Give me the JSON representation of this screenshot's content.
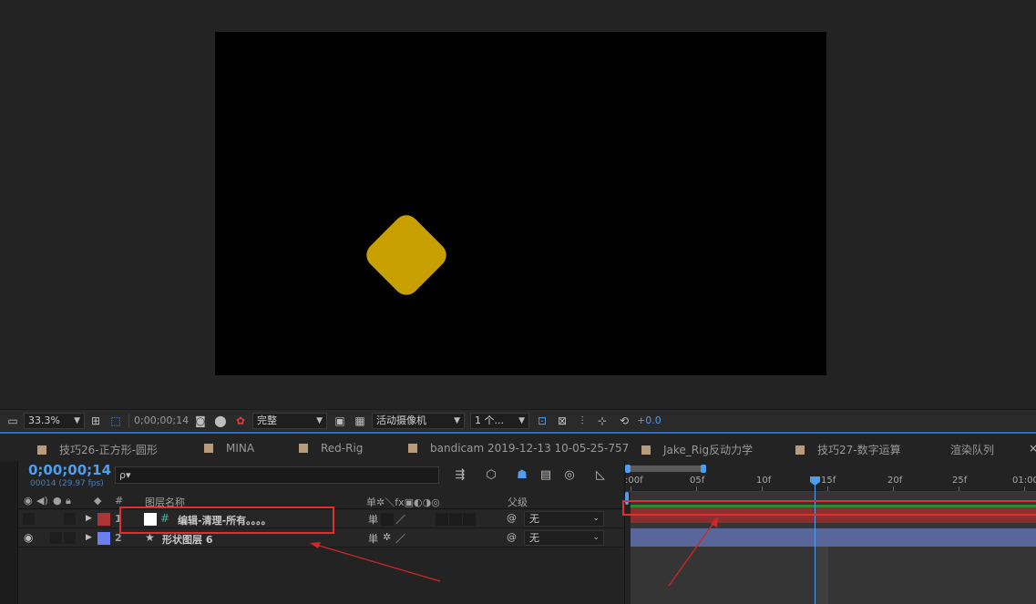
{
  "viewer": {
    "toolbar": {
      "zoom": "33.3%",
      "timecode": "0;00;00;14",
      "resolution": "完整",
      "camera": "活动摄像机",
      "views": "1 个...",
      "exposure": "+0.0"
    }
  },
  "tabs": [
    {
      "label": "技巧26-正方形-圆形"
    },
    {
      "label": "MINA"
    },
    {
      "label": "Red-Rig"
    },
    {
      "label": "bandicam 2019-12-13 10-05-25-757"
    },
    {
      "label": "Jake_Rig反动力学"
    },
    {
      "label": "技巧27-数字运算"
    },
    {
      "label": "渲染队列"
    }
  ],
  "close_glyph": "×",
  "timeline_panel": {
    "current_time": "0;00;00;14",
    "frame_info": "00014 (29.97 fps)",
    "search_glyph": "ρ▾",
    "headers": {
      "num": "#",
      "layer_name": "图层名称",
      "switch_glyphs": "单✲＼fx▣◐◑◎",
      "parent": "父级"
    },
    "layers": [
      {
        "num": "1",
        "type_glyph": "#",
        "name": "编辑-清理-所有。。。。",
        "label_color": "#b13434",
        "parent": "无"
      },
      {
        "num": "2",
        "type_glyph": "★",
        "name": "形状图层 6",
        "label_color": "#6a7ff0",
        "parent": "无"
      }
    ]
  },
  "ruler": {
    "labels": [
      ":00f",
      "05f",
      "10f",
      "15f",
      "20f",
      "25f",
      "01:00"
    ]
  },
  "colors": {
    "accent": "#4e9ef0",
    "shape_fill": "#c7a000",
    "annotation": "#e03030"
  }
}
